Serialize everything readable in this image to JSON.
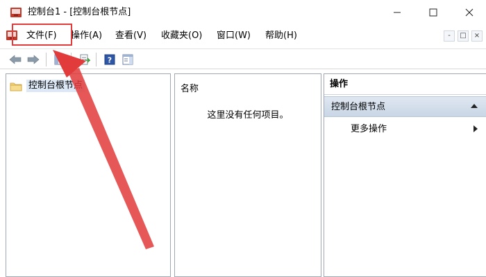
{
  "window": {
    "title": "控制台1 - [控制台根节点]",
    "icons": {
      "app": "mmc-console-icon",
      "min": "minimize-icon",
      "max": "maximize-icon",
      "close": "close-icon"
    }
  },
  "menu": {
    "items": [
      {
        "label": "文件(F)"
      },
      {
        "label": "操作(A)"
      },
      {
        "label": "查看(V)"
      },
      {
        "label": "收藏夹(O)"
      },
      {
        "label": "窗口(W)"
      },
      {
        "label": "帮助(H)"
      }
    ],
    "mdi_buttons": [
      "-",
      "□",
      "×"
    ]
  },
  "toolbar": {
    "icons": [
      "back-arrow-icon",
      "forward-arrow-icon",
      "show-hide-tree-icon",
      "export-list-icon",
      "help-icon",
      "show-hide-action-pane-icon"
    ]
  },
  "tree": {
    "root_label": "控制台根节点"
  },
  "list": {
    "column_header": "名称",
    "empty_message": "这里没有任何项目。"
  },
  "actions": {
    "header": "操作",
    "section_title": "控制台根节点",
    "more_actions": "更多操作"
  },
  "annotation": {
    "highlight_color": "#e23b3b",
    "arrow_color": "#e23b3b"
  }
}
